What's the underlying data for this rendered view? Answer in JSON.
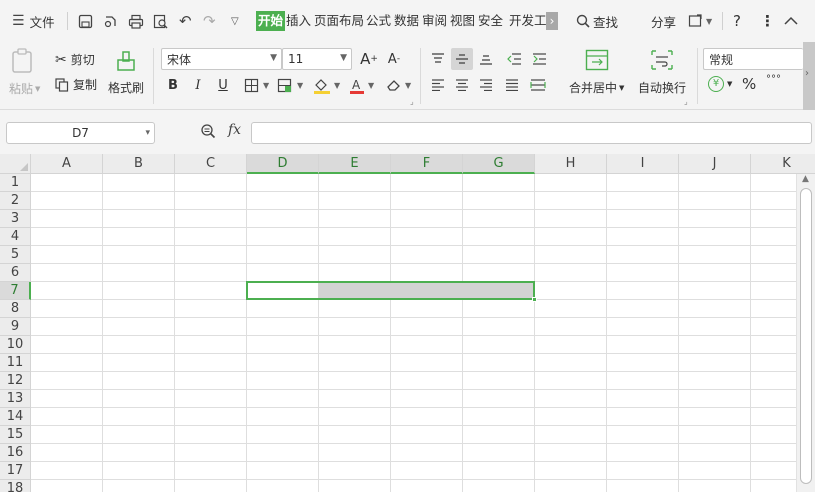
{
  "menubar": {
    "file_label": "文件",
    "tabs": [
      {
        "label": "开始",
        "active": true
      },
      {
        "label": "插入"
      },
      {
        "label": "页面布局"
      },
      {
        "label": "公式"
      },
      {
        "label": "数据"
      },
      {
        "label": "审阅"
      },
      {
        "label": "视图"
      },
      {
        "label": "安全"
      },
      {
        "label": "开发工"
      }
    ],
    "more_glyph": "›",
    "search_label": "查找",
    "share_label": "分享",
    "help_glyph": "?",
    "more_glyph_v": "⋮",
    "collapse_glyph": "︿"
  },
  "ribbon": {
    "paste_label": "粘贴",
    "cut_label": "剪切",
    "copy_label": "复制",
    "format_painter_label": "格式刷",
    "font_name": "宋体",
    "font_size": "11",
    "bold_glyph": "B",
    "italic_glyph": "I",
    "underline_glyph": "U",
    "merge_center_label": "合并居中",
    "wrap_text_label": "自动换行",
    "number_format": "常规",
    "currency_glyph": "¥",
    "percent_glyph": "%",
    "inc_font_glyph": "A",
    "dec_font_glyph": "A"
  },
  "formula_bar": {
    "name_box": "D7",
    "fx_label": "fx",
    "formula": ""
  },
  "grid": {
    "columns": [
      "A",
      "B",
      "C",
      "D",
      "E",
      "F",
      "G",
      "H",
      "I",
      "J",
      "K"
    ],
    "rows": [
      "1",
      "2",
      "3",
      "4",
      "5",
      "6",
      "7",
      "8",
      "9",
      "10",
      "11",
      "12",
      "13",
      "14",
      "15",
      "16",
      "17",
      "18"
    ],
    "selected_columns": [
      "D",
      "E",
      "F",
      "G"
    ],
    "selected_row": "7",
    "active_cell": "D7"
  },
  "colors": {
    "accent": "#4caf50",
    "selection_fill": "#d3d3d3"
  }
}
